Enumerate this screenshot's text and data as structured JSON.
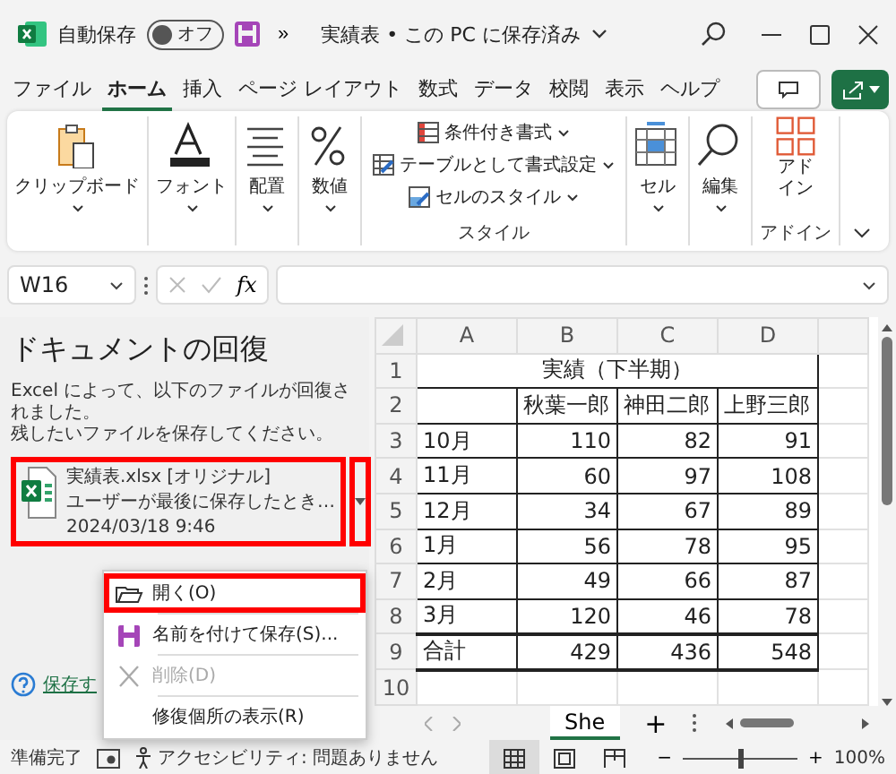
{
  "title_bar": {
    "autosave_label": "自動保存",
    "autosave_state": "オフ",
    "autosave_on": false,
    "overflow": "»",
    "title": "実績表 • この PC に保存済み"
  },
  "menu_tabs": [
    {
      "label": "ファイル",
      "selected": false
    },
    {
      "label": "ホーム",
      "selected": true
    },
    {
      "label": "挿入",
      "selected": false
    },
    {
      "label": "ページ レイアウト",
      "selected": false
    },
    {
      "label": "数式",
      "selected": false
    },
    {
      "label": "データ",
      "selected": false
    },
    {
      "label": "校閲",
      "selected": false
    },
    {
      "label": "表示",
      "selected": false
    },
    {
      "label": "ヘルプ",
      "selected": false
    }
  ],
  "ribbon": {
    "buttons": [
      {
        "kind": "clipboard",
        "label": "クリップボード"
      },
      {
        "kind": "font",
        "label": "フォント"
      },
      {
        "kind": "align",
        "label": "配置"
      },
      {
        "kind": "number",
        "label": "数値"
      }
    ],
    "style_group": {
      "items": [
        {
          "kind": "conditional",
          "label": "条件付き書式"
        },
        {
          "kind": "table",
          "label": "テーブルとして書式設定"
        },
        {
          "kind": "cellstyle",
          "label": "セルのスタイル"
        }
      ],
      "label": "スタイル"
    },
    "buttons_after": [
      {
        "kind": "cells",
        "label": "セル"
      },
      {
        "kind": "edit",
        "label": "編集"
      }
    ],
    "addin_group": {
      "button": "アドイン",
      "label": "アドイン"
    }
  },
  "formula_bar": {
    "name_box": "W16",
    "function_button": "fx"
  },
  "recovery": {
    "title": "ドキュメントの回復",
    "message_lines": [
      "Excel によって、以下のファイルが回復されました。",
      "残したいファイルを保存してください。"
    ],
    "files": [
      {
        "name": "実績表.xlsx [オリジナル]",
        "description": "ユーザーが最後に保存したとき…",
        "time": "2024/03/18 9:46",
        "highlighted": true
      }
    ],
    "help_link": "保存す",
    "menu": [
      {
        "kind": "open",
        "label": "開く(O)",
        "disabled": false,
        "highlighted": true
      },
      {
        "kind": "save",
        "label": "名前を付けて保存(S)...",
        "disabled": false,
        "highlighted": false
      },
      {
        "kind": "delete",
        "label": "削除(D)",
        "disabled": true,
        "highlighted": false
      },
      {
        "kind": "plain",
        "label": "修復個所の表示(R)",
        "disabled": false,
        "highlighted": false
      }
    ]
  },
  "sheet": {
    "columns": [
      "A",
      "B",
      "C",
      "D"
    ],
    "rows": [
      {
        "header": "1",
        "kind": "title",
        "cells": [
          {
            "text": "実績（下半期）",
            "colspan": 4
          }
        ]
      },
      {
        "header": "2",
        "kind": "names",
        "cells": [
          "",
          "秋葉一郎",
          "神田二郎",
          "上野三郎"
        ]
      },
      {
        "header": "3",
        "kind": "data",
        "cells": [
          "10月",
          "110",
          "82",
          "91"
        ]
      },
      {
        "header": "4",
        "kind": "data",
        "cells": [
          "11月",
          "60",
          "97",
          "108"
        ]
      },
      {
        "header": "5",
        "kind": "data",
        "cells": [
          "12月",
          "34",
          "67",
          "89"
        ]
      },
      {
        "header": "6",
        "kind": "data",
        "cells": [
          "1月",
          "56",
          "78",
          "95"
        ]
      },
      {
        "header": "7",
        "kind": "data",
        "cells": [
          "2月",
          "49",
          "66",
          "87"
        ]
      },
      {
        "header": "8",
        "kind": "data",
        "cells": [
          "3月",
          "120",
          "46",
          "78"
        ]
      },
      {
        "header": "9",
        "kind": "total",
        "cells": [
          "合計",
          "429",
          "436",
          "548"
        ]
      },
      {
        "header": "10",
        "kind": "empty",
        "cells": []
      }
    ],
    "sheet_tabs": [
      {
        "label": "She",
        "selected": true
      }
    ],
    "add_sheet": "+"
  },
  "status_bar": {
    "ready": "準備完了",
    "accessibility": "アクセシビリティ: 問題ありません",
    "views": [
      {
        "kind": "normal",
        "selected": true
      },
      {
        "kind": "page-layout",
        "selected": false
      },
      {
        "kind": "page-break",
        "selected": false
      }
    ],
    "zoom": {
      "level": 0.5,
      "minus": "−",
      "plus": "+",
      "reading": "100%"
    }
  }
}
